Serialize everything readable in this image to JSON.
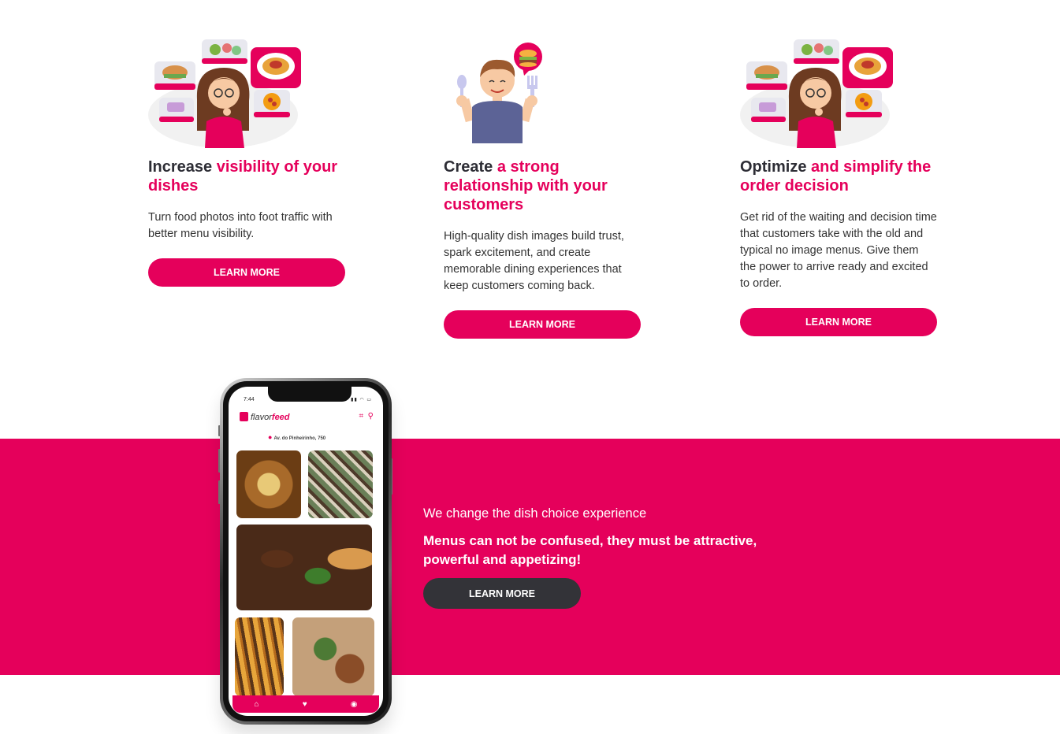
{
  "features": [
    {
      "title_plain": "Increase ",
      "title_accent": "visibility of your dishes",
      "text": "Turn food photos into foot traffic with better menu visibility.",
      "button": "LEARN MORE",
      "illustration": "girl-thinking-food-icon"
    },
    {
      "title_plain": "Create ",
      "title_accent": "a strong relationship with your customers",
      "text": "High-quality dish images build trust, spark excitement, and create memorable dining experiences that keep customers coming back.",
      "button": "LEARN MORE",
      "illustration": "man-with-fork-spoon-icon"
    },
    {
      "title_plain": "Optimize ",
      "title_accent": "and simplify the order decision",
      "text": "Get rid of the waiting and decision time that customers take with the old and typical no image menus. Give them the power to arrive ready and excited to order.",
      "button": "LEARN MORE",
      "illustration": "girl-thinking-food-icon"
    }
  ],
  "band": {
    "subtitle": "We change the dish choice experience",
    "headline": "Menus can not be confused, they must be attractive, powerful and appetizing!",
    "button": "LEARN MORE"
  },
  "phone": {
    "time": "7:44",
    "brand_part1": "flavor",
    "brand_part2": "feed",
    "address": "Av. do Pinheirinho, 750"
  },
  "colors": {
    "accent": "#e5005b",
    "dark": "#2d2d35",
    "button_dark": "#333338"
  }
}
